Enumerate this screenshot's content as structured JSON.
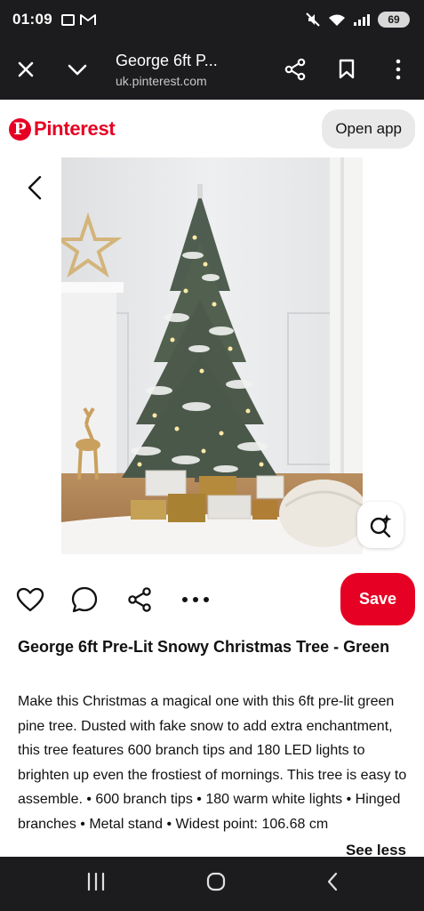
{
  "status_bar": {
    "time": "01:09",
    "battery": "69",
    "icons": [
      "screenshot-icon",
      "gmail-icon",
      "mute-icon",
      "wifi-icon",
      "signal-icon",
      "battery-icon"
    ]
  },
  "browser": {
    "title": "George 6ft P...",
    "url": "uk.pinterest.com",
    "icons": [
      "close-icon",
      "chevron-down-icon",
      "share-icon",
      "bookmark-icon",
      "more-vertical-icon"
    ]
  },
  "header": {
    "logo_mark": "P",
    "logo_text": "Pinterest",
    "open_app_label": "Open app"
  },
  "pin": {
    "image_subject": "Snowy pre-lit Christmas tree with gifts",
    "actions": [
      "heart-icon",
      "comment-icon",
      "share-icon",
      "more-horizontal-icon"
    ],
    "save_label": "Save",
    "title": "George 6ft Pre-Lit Snowy Christmas Tree - Green",
    "description": "Make this Christmas a magical one with this 6ft pre-lit green pine tree. Dusted with fake snow to add extra enchantment, this tree features 600 branch tips and 180 LED lights to brighten up even the frostiest of mornings. This tree is easy to assemble. • 600 branch tips • 180 warm white lights • Hinged branches • Metal stand • Widest point: 106.68 cm",
    "see_less_label": "See less"
  },
  "colors": {
    "brand": "#e60023",
    "dark_bar": "#1c1c1e",
    "pill_bg": "#e9e9e9"
  },
  "nav_bar": {
    "icons": [
      "recent-apps-icon",
      "home-icon",
      "back-icon"
    ]
  }
}
